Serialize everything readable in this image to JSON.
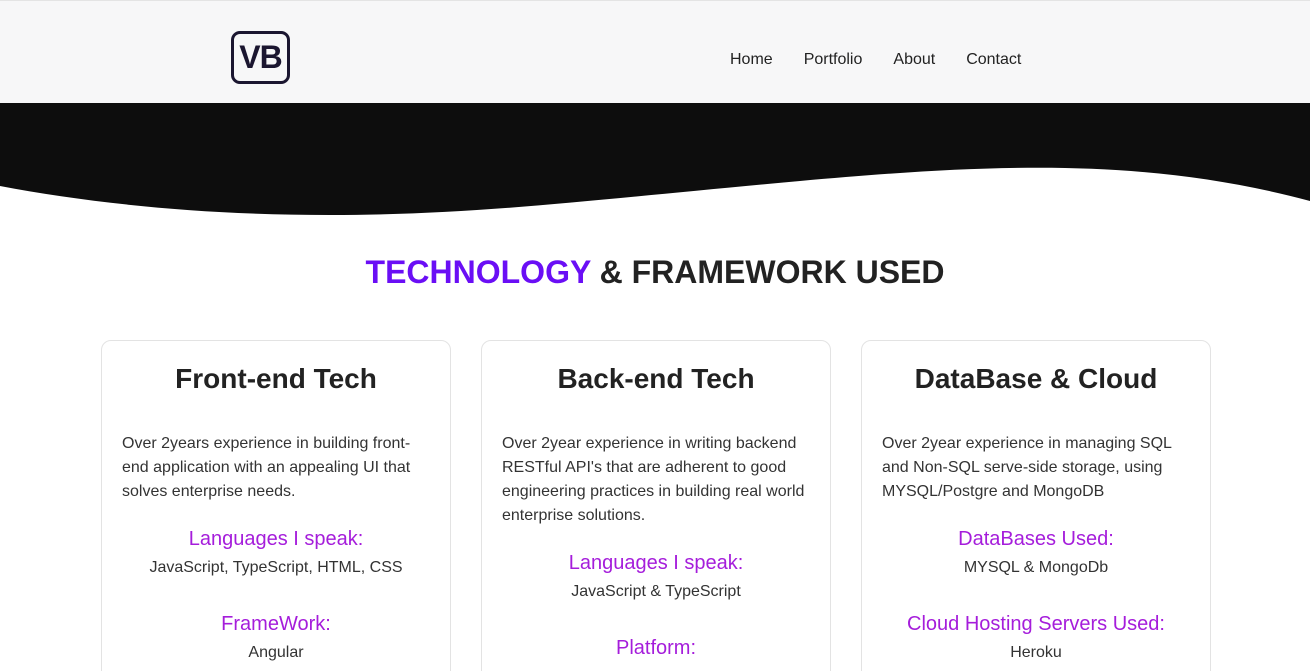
{
  "header": {
    "logo_text": "VB",
    "nav": [
      "Home",
      "Portfolio",
      "About",
      "Contact"
    ]
  },
  "section": {
    "title_accent": "TECHNOLOGY",
    "title_rest": " & FRAMEWORK USED"
  },
  "cards": [
    {
      "title": "Front-end Tech",
      "description": "Over 2years experience in building front-end application with an appealing UI that solves enterprise needs.",
      "sub1_label": "Languages I speak:",
      "sub1_value": "JavaScript, TypeScript, HTML, CSS",
      "sub2_label": "FrameWork:",
      "sub2_value": "Angular"
    },
    {
      "title": "Back-end Tech",
      "description": "Over 2year experience in writing backend RESTful API's that are adherent to good engineering practices in building real world enterprise solutions.",
      "sub1_label": "Languages I speak:",
      "sub1_value": "JavaScript & TypeScript",
      "sub2_label": "Platform:",
      "sub2_value": ""
    },
    {
      "title": "DataBase & Cloud",
      "description": "Over 2year experience in managing SQL and Non-SQL serve-side storage, using MYSQL/Postgre and MongoDB",
      "sub1_label": "DataBases Used:",
      "sub1_value": "MYSQL & MongoDb",
      "sub2_label": "Cloud Hosting Servers Used:",
      "sub2_value": "Heroku"
    }
  ],
  "colors": {
    "accent_title": "#6a0ef5",
    "accent_sub": "#a51ddb",
    "hero_band": "#0d0d0d"
  }
}
